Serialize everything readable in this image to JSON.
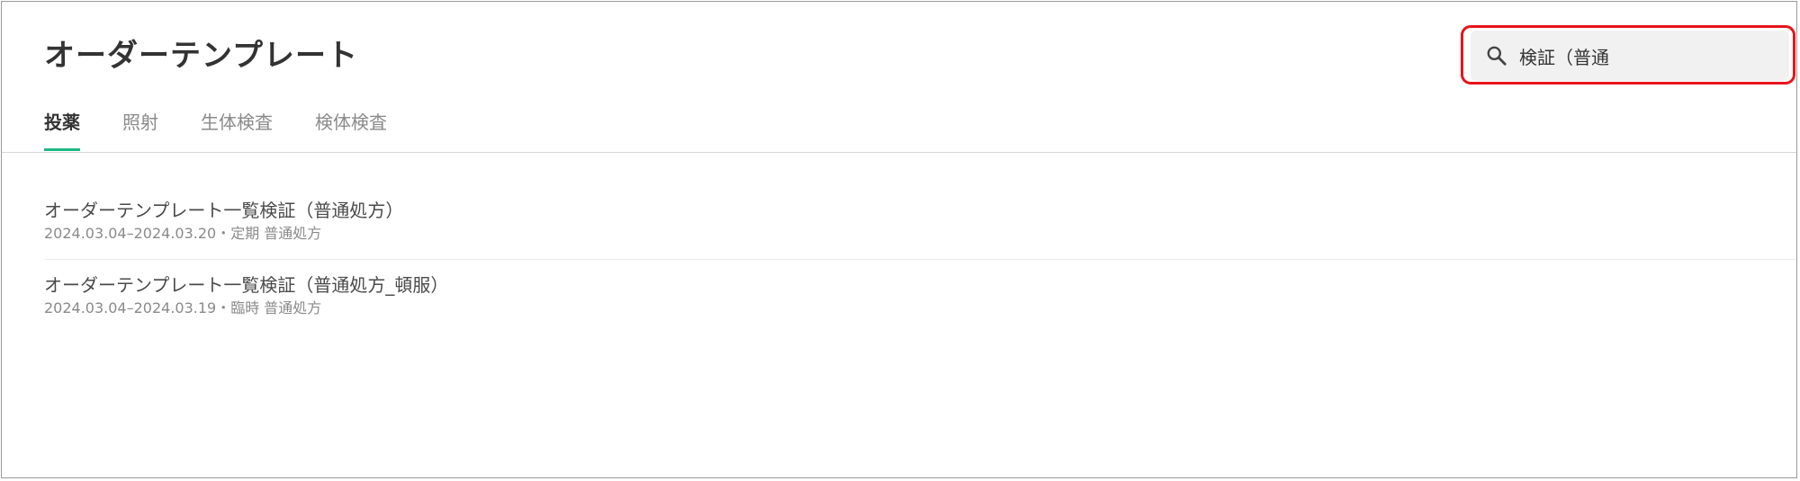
{
  "header": {
    "title": "オーダーテンプレート"
  },
  "search": {
    "value": "検証（普通",
    "icon": "search-icon"
  },
  "tabs": [
    {
      "label": "投薬",
      "active": true
    },
    {
      "label": "照射",
      "active": false
    },
    {
      "label": "生体検査",
      "active": false
    },
    {
      "label": "検体検査",
      "active": false
    }
  ],
  "list": [
    {
      "title": "オーダーテンプレート一覧検証（普通処方）",
      "meta": "2024.03.04–2024.03.20・定期 普通処方"
    },
    {
      "title": "オーダーテンプレート一覧検証（普通処方_頓服）",
      "meta": "2024.03.04–2024.03.19・臨時 普通処方"
    }
  ],
  "colors": {
    "accent": "#1db883",
    "highlight_border": "#e8141b",
    "search_bg": "#f1f1f1"
  }
}
